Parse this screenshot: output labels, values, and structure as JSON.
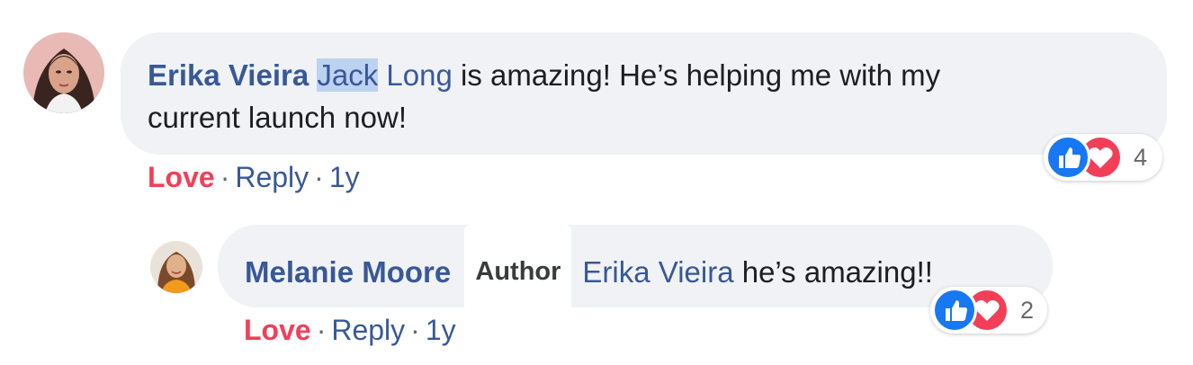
{
  "comment": {
    "author": "Erika Vieira",
    "mention_first": "Jack",
    "mention_last": "Long",
    "text_line1": " is amazing! He’s helping me with my",
    "text_line2": "current launch now!",
    "actions": {
      "love": "Love",
      "reply": "Reply",
      "time": "1y"
    },
    "reactions": {
      "count": "4",
      "icons": [
        "like-icon",
        "love-icon"
      ]
    }
  },
  "reply": {
    "author": "Melanie Moore",
    "badge": "Author",
    "mention": "Erika Vieira",
    "text": " he’s amazing!!",
    "actions": {
      "love": "Love",
      "reply": "Reply",
      "time": "1y"
    },
    "reactions": {
      "count": "2",
      "icons": [
        "like-icon",
        "love-icon"
      ]
    }
  },
  "colors": {
    "link": "#385898",
    "love": "#f33e58",
    "bubble": "#f0f2f5",
    "like": "#1877f2"
  }
}
